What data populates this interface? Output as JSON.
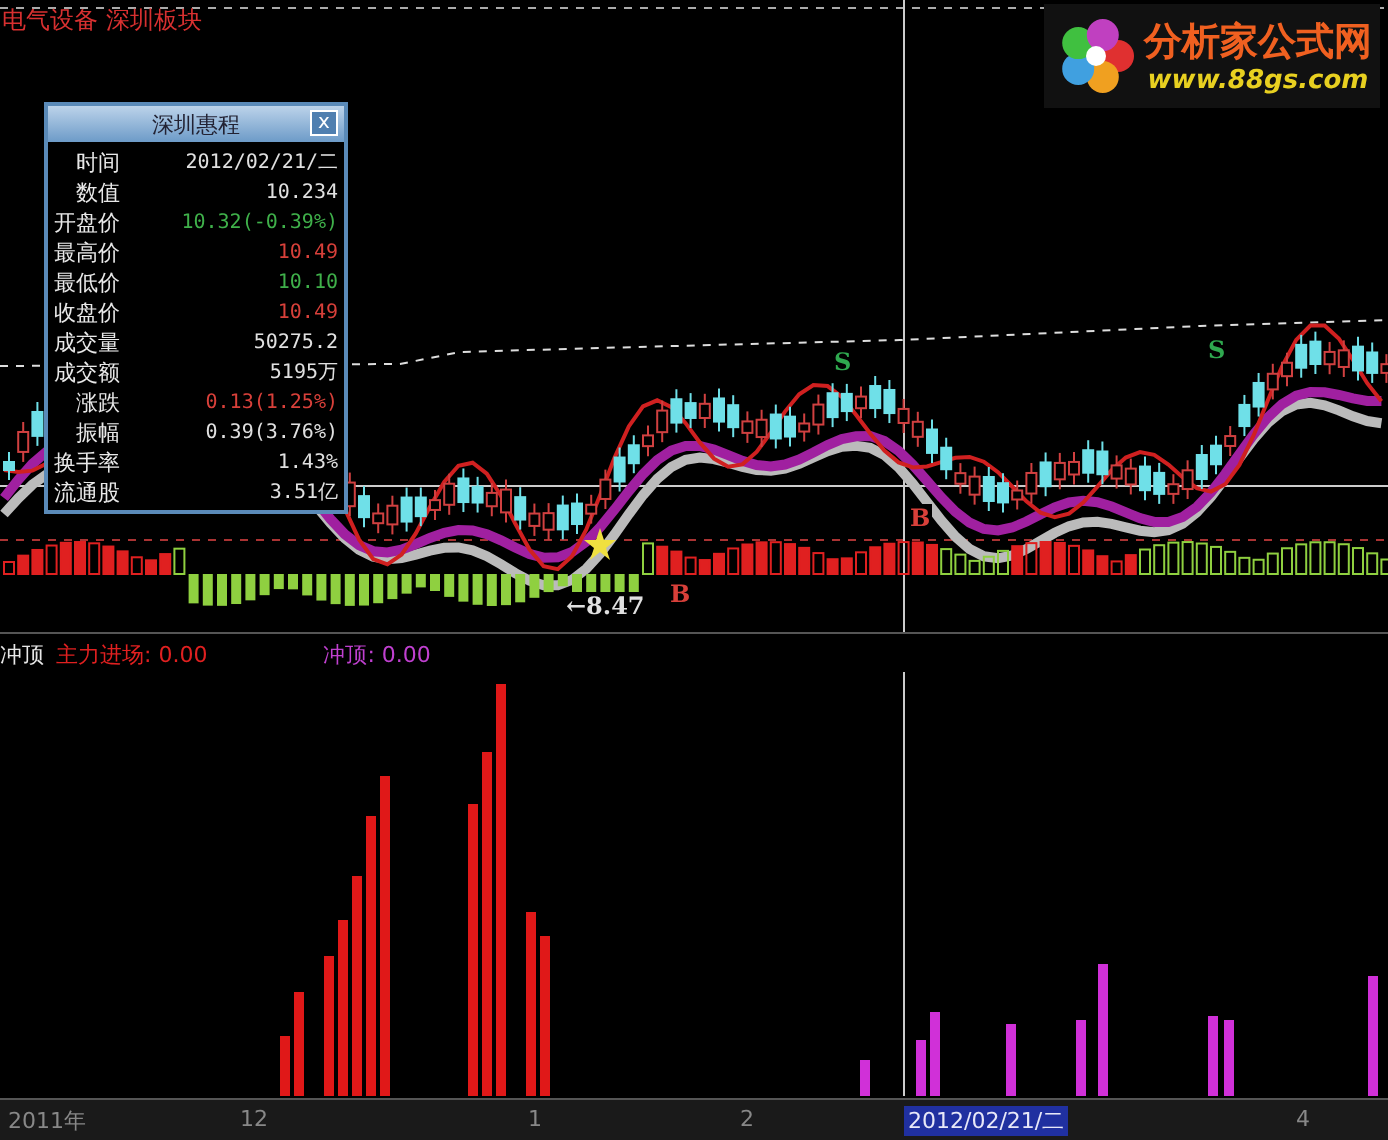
{
  "chart_title": "电气设备 深圳板块",
  "logo": {
    "name": "分析家公式网",
    "url": "www.88gs.com"
  },
  "info_panel": {
    "title": "深圳惠程",
    "close": "x",
    "rows": [
      {
        "label": "时间",
        "value": "2012/02/21/二",
        "color": "#e0e0e0"
      },
      {
        "label": "数值",
        "value": "10.234",
        "color": "#e0e0e0"
      },
      {
        "label": "开盘价",
        "value": "10.32(-0.39%)",
        "color": "#3fb04a"
      },
      {
        "label": "最高价",
        "value": "10.49",
        "color": "#d8403a"
      },
      {
        "label": "最低价",
        "value": "10.10",
        "color": "#3fb04a"
      },
      {
        "label": "收盘价",
        "value": "10.49",
        "color": "#d8403a"
      },
      {
        "label": "成交量",
        "value": "50275.2",
        "color": "#e0e0e0"
      },
      {
        "label": "成交额",
        "value": "5195万",
        "color": "#e0e0e0"
      },
      {
        "label": "涨跌",
        "value": "0.13(1.25%)",
        "color": "#d8403a"
      },
      {
        "label": "振幅",
        "value": "0.39(3.76%)",
        "color": "#e0e0e0"
      },
      {
        "label": "换手率",
        "value": "1.43%",
        "color": "#e0e0e0"
      },
      {
        "label": "流通股",
        "value": "3.51亿",
        "color": "#e0e0e0"
      }
    ]
  },
  "markers": [
    {
      "text": "S",
      "color": "#2fa84f"
    },
    {
      "text": "S",
      "color": "#2fa84f"
    },
    {
      "text": "B",
      "color": "#d8403a"
    },
    {
      "text": "B",
      "color": "#d8403a"
    },
    {
      "text": "←8.47",
      "color": "#e0e0e0"
    }
  ],
  "indicator_panel": {
    "name": "冲顶",
    "legend": [
      {
        "text": "主力进场: 0.00",
        "color": "#e02020"
      },
      {
        "text": "冲顶: 0.00",
        "color": "#c040d0"
      }
    ]
  },
  "time_axis": [
    {
      "label": "2011年",
      "selected": false
    },
    {
      "label": "12",
      "selected": false
    },
    {
      "label": "1",
      "selected": false
    },
    {
      "label": "2",
      "selected": false
    },
    {
      "label": "2012/02/21/二",
      "selected": true
    },
    {
      "label": "4",
      "selected": false
    }
  ]
}
